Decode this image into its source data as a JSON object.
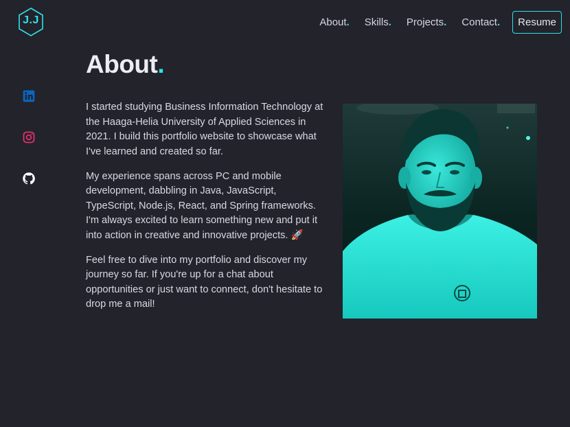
{
  "logo": {
    "text": "J.J"
  },
  "nav": {
    "items": [
      {
        "label": "About",
        "dot": "."
      },
      {
        "label": "Skills",
        "dot": "."
      },
      {
        "label": "Projects",
        "dot": "."
      },
      {
        "label": "Contact",
        "dot": "."
      }
    ],
    "resume_label": "Resume"
  },
  "social": [
    {
      "icon": "linkedin-icon",
      "color": "#0a66c2"
    },
    {
      "icon": "instagram-icon",
      "color": "#e1306c"
    },
    {
      "icon": "github-icon",
      "color": "#ffffff"
    }
  ],
  "about": {
    "title": "About",
    "title_dot": ".",
    "paragraphs": [
      "I started studying Business Information Technology at the Haaga-Helia University of Applied Sciences in 2021. I build this portfolio website to showcase what I've learned and created so far.",
      "My experience spans across PC and mobile development, dabbling in Java, JavaScript, TypeScript, Node.js, React, and Spring frameworks. I'm always excited to learn something new and put it into action in creative and innovative projects. 🚀",
      "Feel free to dive into my portfolio and discover my journey so far. If you're up for a chat about opportunities or just want to connect, don't hesitate to drop me a mail!"
    ]
  },
  "theme": {
    "accent": "#2fe3ea",
    "background": "#23232b",
    "text": "#d9d9e5"
  }
}
